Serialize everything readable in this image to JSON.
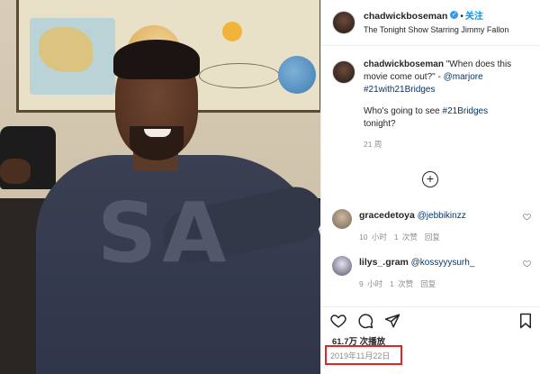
{
  "post": {
    "username": "chadwickboseman",
    "follow_label": "关注",
    "location": "The Tonight Show Starring Jimmy Fallon",
    "caption_quote": "\"When does this movie come out?\" - ",
    "caption_mention": "@marjore",
    "caption_hashtag1": "#21with21Bridges",
    "caption_line2_prefix": "Who's going to see ",
    "caption_hashtag2": "#21Bridges",
    "caption_line2_suffix": "tonight?",
    "caption_time": "21 周"
  },
  "comments": [
    {
      "username": "gracedetoya",
      "text": "@jebbikinzz",
      "time": "10 小时",
      "likes": "1 次赞",
      "reply": "回复"
    },
    {
      "username": "lilys_.gram",
      "text": "@kossyyysurh_",
      "time": "9 小时",
      "likes": "1 次赞",
      "reply": "回复"
    }
  ],
  "stats": {
    "views": "61.7万 次播放",
    "date": "2019年11月22日"
  },
  "photo": {
    "shirt_text": "SA"
  },
  "icons": [
    "verified-icon",
    "add-comment-icon",
    "heart-icon",
    "comment-icon",
    "share-icon",
    "bookmark-icon"
  ],
  "colors": {
    "link": "#00376b",
    "follow": "#0095f6",
    "highlight_box": "#e0262b"
  }
}
